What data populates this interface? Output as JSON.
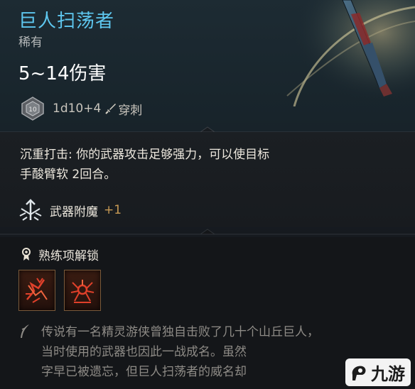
{
  "item": {
    "name": "巨人扫荡者",
    "rarity": "稀有",
    "damage": "5~14伤害",
    "dice": "1d10+4",
    "damage_type": "穿刺"
  },
  "passive": {
    "line1": "沉重打击: 你的武器攻击足够强力，可以使目标",
    "line2": "手酸臂软 2回合。"
  },
  "enchantment": {
    "label": "武器附魔",
    "value": "+1"
  },
  "proficiency": {
    "title": "熟练项解锁",
    "skills": [
      {
        "icon": "rush-attack-icon"
      },
      {
        "icon": "spider-attack-icon"
      }
    ]
  },
  "lore": {
    "line1": "传说有一名精灵游侠曾独自击败了几十个山丘巨人，",
    "line2": "当时使用的武器也因此一战成名。虽然",
    "line3": "字早已被遗忘，但巨人扫荡者的威名却"
  },
  "watermark": {
    "text": "九游"
  },
  "colors": {
    "name": "#5ec7ef",
    "enchant_value": "#c79a54",
    "lore": "#8e8b86",
    "skill_border": "#7a5a3a",
    "skill_glyph": "#e0402a"
  }
}
